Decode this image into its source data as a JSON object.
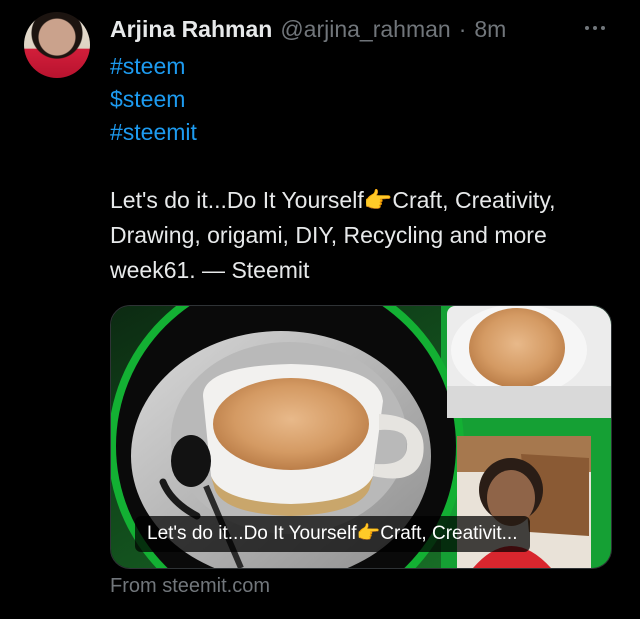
{
  "post": {
    "author_name": "Arjina Rahman",
    "handle": "@arjina_rahman",
    "separator": "·",
    "time": "8m",
    "tags": [
      "#steem",
      "$steem",
      "#steemit"
    ],
    "body": "Let's do it...Do It Yourself👉Craft, Creativity, Drawing, origami, DIY, Recycling and more week61. — Steemit"
  },
  "link_card": {
    "title": "Let's do it...Do It Yourself👉Craft, Creativit...",
    "source": "From steemit.com"
  },
  "colors": {
    "background": "#000000",
    "text": "#e7e9ea",
    "muted": "#71767b",
    "link": "#1d9bf0",
    "card_green": "#1fae3a"
  },
  "icons": {
    "more": "more-horizontal-icon"
  }
}
